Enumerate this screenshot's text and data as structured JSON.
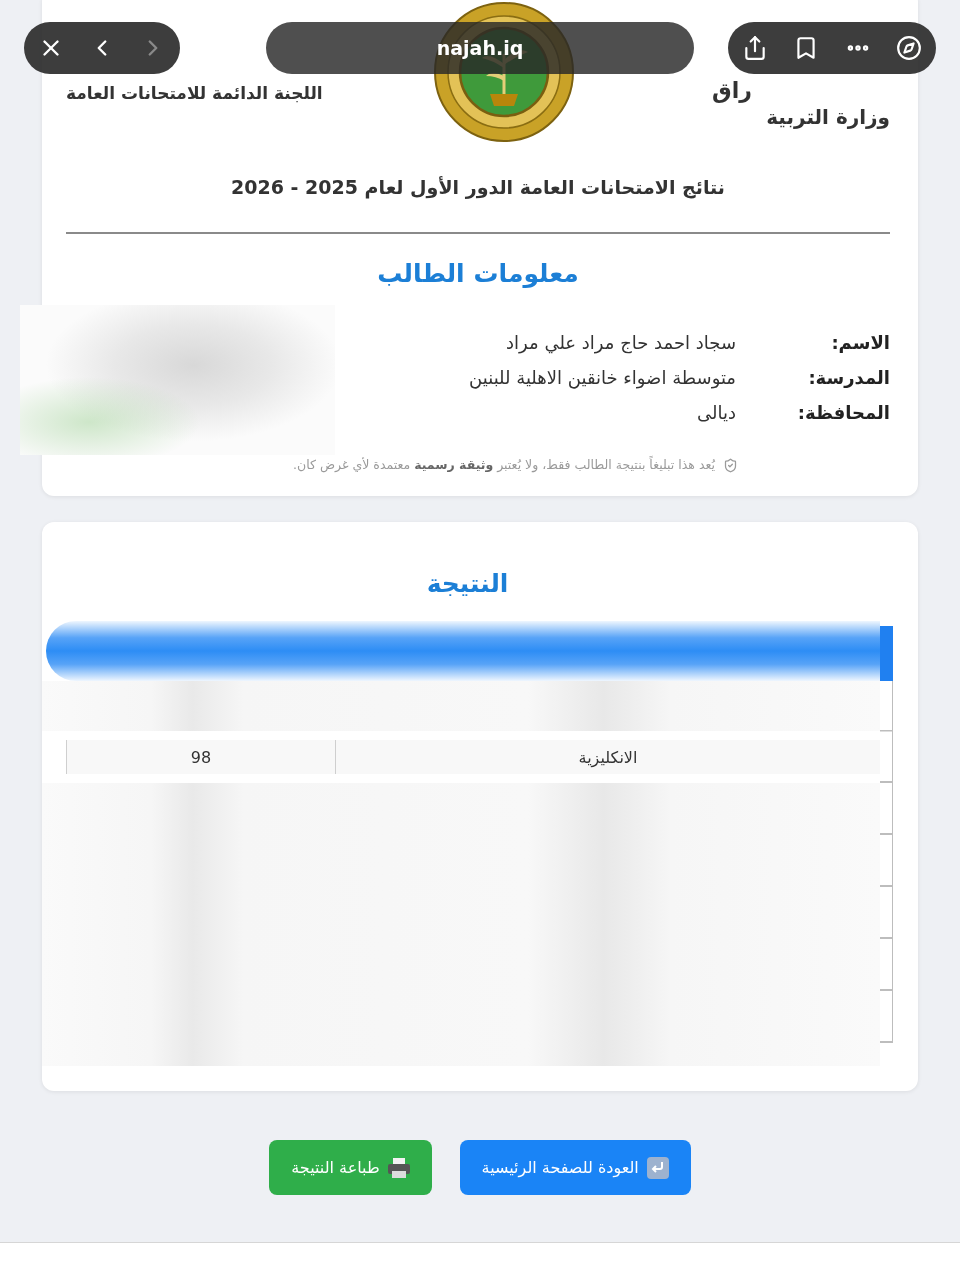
{
  "browser_bar": {
    "url": "najah.iq",
    "back_disabled": false,
    "forward_disabled": true
  },
  "header": {
    "right_lines": [
      "راق",
      "وزارة التربية"
    ],
    "left_line": "اللجنة الدائمة للامتحانات العامة"
  },
  "title": "نتائج الامتحانات العامة الدور الأول لعام 2025 - 2026",
  "student_info": {
    "heading": "معلومات الطالب",
    "fields": [
      {
        "label": "الاسم:",
        "value": "سجاد احمد حاج مراد علي مراد"
      },
      {
        "label": "المدرسة:",
        "value": "متوسطة اضواء خانقين الاهلية للبنين"
      },
      {
        "label": "المحافظة:",
        "value": "ديالى"
      }
    ],
    "note": "يُعد هذا تبليغاً بنتيجة الطالب فقط، ولا يُعتبر **وثيقة رسمية** معتمدة لأي غرض كان."
  },
  "result": {
    "heading": "النتيجة",
    "rows": [
      {
        "subject": "الانكليزية",
        "grade": "98"
      }
    ]
  },
  "buttons": [
    {
      "kind": "home",
      "label": "العودة للصفحة الرئيسية"
    },
    {
      "kind": "print",
      "label": "طباعة النتيجة"
    }
  ]
}
